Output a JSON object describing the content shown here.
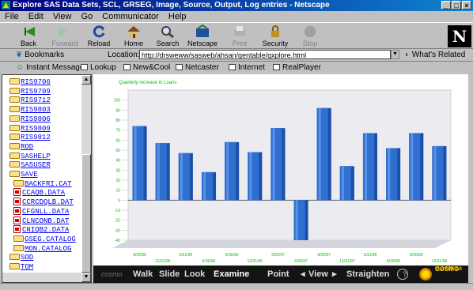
{
  "window": {
    "title": "Explore SAS Data Sets, SCL, GRSEG, Image, Source, Output, Log entries - Netscape"
  },
  "menu": [
    "File",
    "Edit",
    "View",
    "Go",
    "Communicator",
    "Help"
  ],
  "toolbar": {
    "back": "Back",
    "forward": "Forward",
    "reload": "Reload",
    "home": "Home",
    "search": "Search",
    "netscape": "Netscape",
    "print": "Print",
    "security": "Security",
    "stop": "Stop",
    "logo": "N"
  },
  "location": {
    "bookmarks": "Bookmarks",
    "label": "Location:",
    "url": "http://drsweww/sasweb/ahsan/gentable/gxplore.html",
    "related": "What's Related"
  },
  "personal": {
    "instant_message": "Instant Message",
    "lookup": "Lookup",
    "new_cool": "New&Cool",
    "netcaster": "Netcaster",
    "internet": "Internet",
    "realplayer": "RealPlayer"
  },
  "sidebar": {
    "items": [
      {
        "label": "RIS9706",
        "icon": "folder"
      },
      {
        "label": "RIS9709",
        "icon": "folder"
      },
      {
        "label": "RIS9712",
        "icon": "folder"
      },
      {
        "label": "RIS9803",
        "icon": "folder"
      },
      {
        "label": "RIS9806",
        "icon": "folder"
      },
      {
        "label": "RIS9809",
        "icon": "folder"
      },
      {
        "label": "RIS9812",
        "icon": "folder"
      },
      {
        "label": "ROD",
        "icon": "folder"
      },
      {
        "label": "SASHELP",
        "icon": "folder"
      },
      {
        "label": "SASUSER",
        "icon": "folder"
      },
      {
        "label": "SAVE",
        "icon": "folder-open"
      },
      {
        "label": "BACKFRI.CAT",
        "icon": "folder"
      },
      {
        "label": "CCAQB.DATA",
        "icon": "file"
      },
      {
        "label": "CCRCDQLB.DAT",
        "icon": "file"
      },
      {
        "label": "CFGNLL.DATA",
        "icon": "file"
      },
      {
        "label": "CLNCONB.DAT",
        "icon": "file"
      },
      {
        "label": "CNIQB2.DATA",
        "icon": "file"
      },
      {
        "label": "GSEG.CATALOG",
        "icon": "folder"
      },
      {
        "label": "MON.CATALOG",
        "icon": "folder"
      },
      {
        "label": "SOD",
        "icon": "folder"
      },
      {
        "label": "TOM",
        "icon": "folder"
      }
    ]
  },
  "chart_data": {
    "type": "bar",
    "title": "Quarterly increase in Loans",
    "ylim": [
      -40,
      110
    ],
    "yticks": [
      -40,
      -30,
      -20,
      -10,
      0,
      10,
      20,
      30,
      40,
      50,
      60,
      70,
      80,
      90,
      100
    ],
    "categories": [
      "9/30/95",
      "12/31/95",
      "3/31/96",
      "6/30/96",
      "9/30/96",
      "12/31/96",
      "3/31/97",
      "6/30/97",
      "9/30/97",
      "12/31/97",
      "3/31/98",
      "6/30/98",
      "9/30/98",
      "12/31/98"
    ],
    "values": [
      74,
      57,
      47,
      28,
      58,
      48,
      72,
      -40,
      92,
      34,
      67,
      52,
      67,
      54
    ],
    "bar_color": "#2e6fd0",
    "label_color": "#00c000",
    "grid": false
  },
  "viewer_nav": {
    "brand": "cosmo",
    "walk": "Walk",
    "slide": "Slide",
    "look": "Look",
    "examine": "Examine",
    "point": "Point",
    "view": "View",
    "straighten": "Straighten",
    "help": "?",
    "logo_main": "COSMO",
    "logo_sub": "PLAYER 1.0"
  }
}
